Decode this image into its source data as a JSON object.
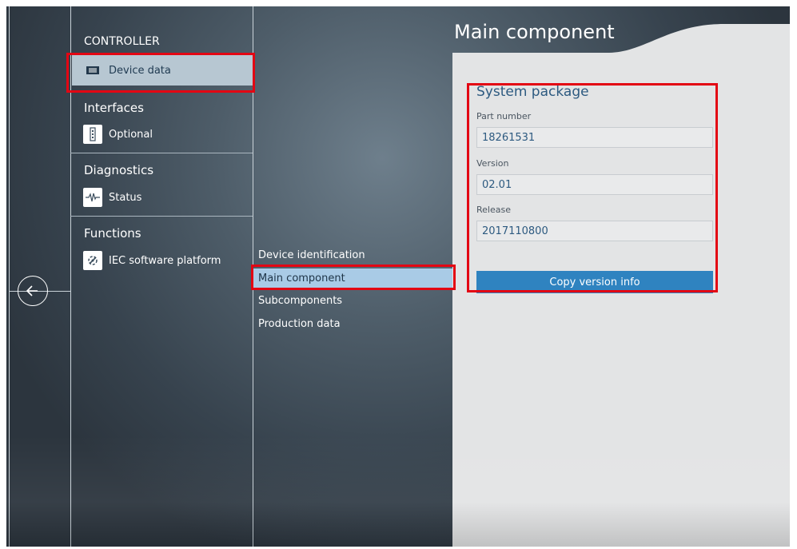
{
  "sidebar": {
    "title": "CONTROLLER",
    "sections": [
      {
        "title": "",
        "item": {
          "label": "Device data",
          "icon": "device-data-icon",
          "selected": true
        }
      },
      {
        "title": "Interfaces",
        "item": {
          "label": "Optional",
          "icon": "optional-interface-icon"
        }
      },
      {
        "title": "Diagnostics",
        "item": {
          "label": "Status",
          "icon": "status-pulse-icon"
        }
      },
      {
        "title": "Functions",
        "item": {
          "label": "IEC software platform",
          "icon": "iec-platform-icon"
        }
      }
    ]
  },
  "submenu": {
    "items": [
      {
        "label": "Device identification"
      },
      {
        "label": "Main component",
        "selected": true
      },
      {
        "label": "Subcomponents"
      },
      {
        "label": "Production data"
      }
    ]
  },
  "main": {
    "title": "Main component",
    "group_title": "System package",
    "fields": [
      {
        "label": "Part number",
        "value": "18261531"
      },
      {
        "label": "Version",
        "value": "02.01"
      },
      {
        "label": "Release",
        "value": "2017110800"
      }
    ],
    "copy_button": "Copy version info"
  },
  "colors": {
    "accent": "#2f83c0",
    "selection_highlight": "#e30613",
    "content_bg": "#e3e4e5"
  }
}
